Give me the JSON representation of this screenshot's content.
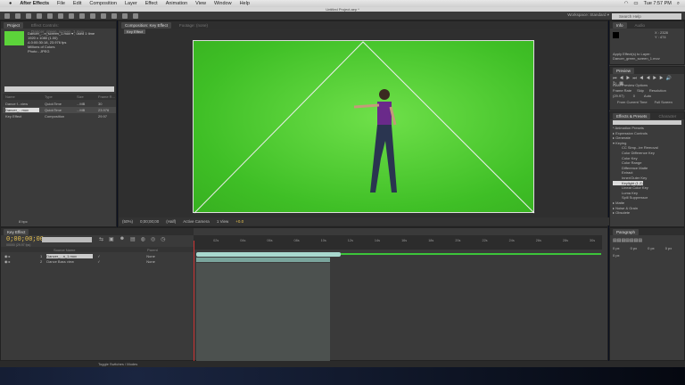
{
  "menubar": {
    "apple": "",
    "items": [
      "After Effects",
      "File",
      "Edit",
      "Composition",
      "Layer",
      "Effect",
      "Animation",
      "View",
      "Window",
      "Help"
    ],
    "clock": "Tue 7:57 PM"
  },
  "window_title": "Untitled Project.aep *",
  "workspace": {
    "label": "Workspace:",
    "value": "Standard"
  },
  "search_help": "Search Help",
  "project": {
    "tabs": [
      "Project",
      "Effect Controls: Dancer_green_screen_1.mov"
    ],
    "info": [
      "Dancer_...n_screen_1.mov ▾ , used 1 time",
      "1920 x 1080 (1.00)",
      "Δ 0:00:30:18, 23.976 fps",
      "Millions of Colors",
      "Photo - JPEG"
    ],
    "columns": [
      "Name",
      "Type",
      "Size",
      "Frame R..."
    ],
    "rows": [
      {
        "name": "Dance f...view",
        "type": "QuickTime",
        "size": "...MB",
        "fps": "30"
      },
      {
        "name": "Dancer_...mov",
        "type": "QuickTime",
        "size": "...MB",
        "fps": "23.976"
      },
      {
        "name": "Key Effect",
        "type": "Composition",
        "size": "",
        "fps": "29.97"
      }
    ],
    "bpc": "8 bpc"
  },
  "viewer": {
    "tabs": [
      "Composition: Key Effect",
      "Footage: (none)"
    ],
    "comp_tab": "Key Effect",
    "zoom": "(50%)",
    "timecode": "0;00;00;00",
    "resolution": "(Half)",
    "camera": "Active Camera",
    "views": "1 View",
    "exposure": "+0.0"
  },
  "info_panel": {
    "tabs": [
      "Info",
      "Audio"
    ],
    "x": "X : 2328",
    "y": "Y : 474",
    "message": "Apply Effect(s) to Layer:",
    "layer": "Dancer_green_screen_1.mov"
  },
  "preview": {
    "title": "Preview",
    "ram": "RAM Preview Options",
    "frame_rate_label": "Frame Rate",
    "skip_label": "Skip",
    "resolution_label": "Resolution",
    "frame_rate": "(29.97)",
    "skip": "0",
    "resolution": "Auto",
    "from_current": "From Current Time",
    "full_screen": "Full Screen"
  },
  "effects": {
    "tabs": [
      "Effects & Presets",
      "Character"
    ],
    "search": "",
    "items": [
      {
        "label": "* Animation Presets",
        "indent": 0
      },
      {
        "label": "▸ Expression Controls",
        "indent": 0
      },
      {
        "label": "▸ Generate",
        "indent": 0
      },
      {
        "label": "▾ Keying",
        "indent": 0
      },
      {
        "label": "CC Simp...ire Removal",
        "indent": 1
      },
      {
        "label": "Color Difference Key",
        "indent": 1
      },
      {
        "label": "Color Key",
        "indent": 1
      },
      {
        "label": "Color Range",
        "indent": 1
      },
      {
        "label": "Difference Matte",
        "indent": 1
      },
      {
        "label": "Extract",
        "indent": 1
      },
      {
        "label": "Inner/Outer Key",
        "indent": 1
      },
      {
        "label": "Keylight (1.2)",
        "indent": 1,
        "selected": true
      },
      {
        "label": "Linear Color Key",
        "indent": 1
      },
      {
        "label": "Luma Key",
        "indent": 1
      },
      {
        "label": "Spill Suppressor",
        "indent": 1
      },
      {
        "label": "▸ Matte",
        "indent": 0
      },
      {
        "label": "▸ Noise & Grain",
        "indent": 0
      },
      {
        "label": "▸ Obsolete",
        "indent": 0
      }
    ]
  },
  "timeline": {
    "tab": "Key Effect",
    "timecode": "0;00;00;00",
    "fps_line": "00000 (29.97 fps)",
    "col_source": "Source Name",
    "col_parent": "Parent",
    "ticks": [
      "02s",
      "04s",
      "06s",
      "08s",
      "10s",
      "12s",
      "14s",
      "16s",
      "18s",
      "20s",
      "22s",
      "24s",
      "26s",
      "28s",
      "30s"
    ],
    "layers": [
      {
        "num": "1",
        "name": "Dancer_...n_1.mov",
        "parent": "None"
      },
      {
        "num": "2",
        "name": "Dance Bass view",
        "parent": "None"
      }
    ],
    "toggle": "Toggle Switches / Modes"
  },
  "paragraph": {
    "tab": "Paragraph",
    "fields": [
      "0 px",
      "0 px",
      "0 px",
      "0 px",
      "0 px"
    ]
  },
  "colors": {
    "green_screen": "#4fcf33",
    "timecode": "#e8c250",
    "layer_bar": "#a9d9cf",
    "cti": "#cc3333"
  }
}
